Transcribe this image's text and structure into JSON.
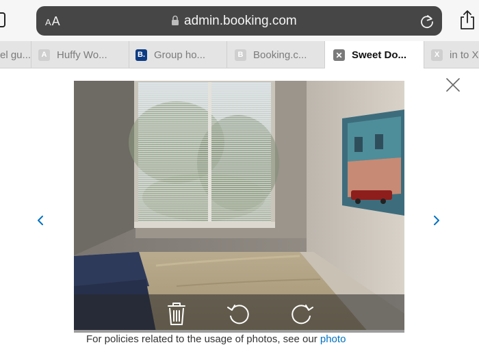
{
  "browser": {
    "text_size_label_small": "A",
    "text_size_label_large": "A",
    "url": "admin.booking.com"
  },
  "tabs": [
    {
      "icon": "",
      "label": "el gu...",
      "active": false
    },
    {
      "icon": "A",
      "label": "Huffy Wo...",
      "active": false
    },
    {
      "icon": "B.",
      "label": "Group ho...",
      "active": false
    },
    {
      "icon": "B",
      "label": "Booking.c...",
      "active": false
    },
    {
      "icon": "✕",
      "label": "Sweet Do...",
      "active": true
    },
    {
      "icon": "X",
      "label": "in to X",
      "active": false
    }
  ],
  "footer": {
    "policy_text": "For policies related to the usage of photos, see our ",
    "policy_link": "photo"
  },
  "colors": {
    "address_bar": "#464646",
    "link": "#0071c2",
    "booking_brand": "#0c3b83"
  }
}
